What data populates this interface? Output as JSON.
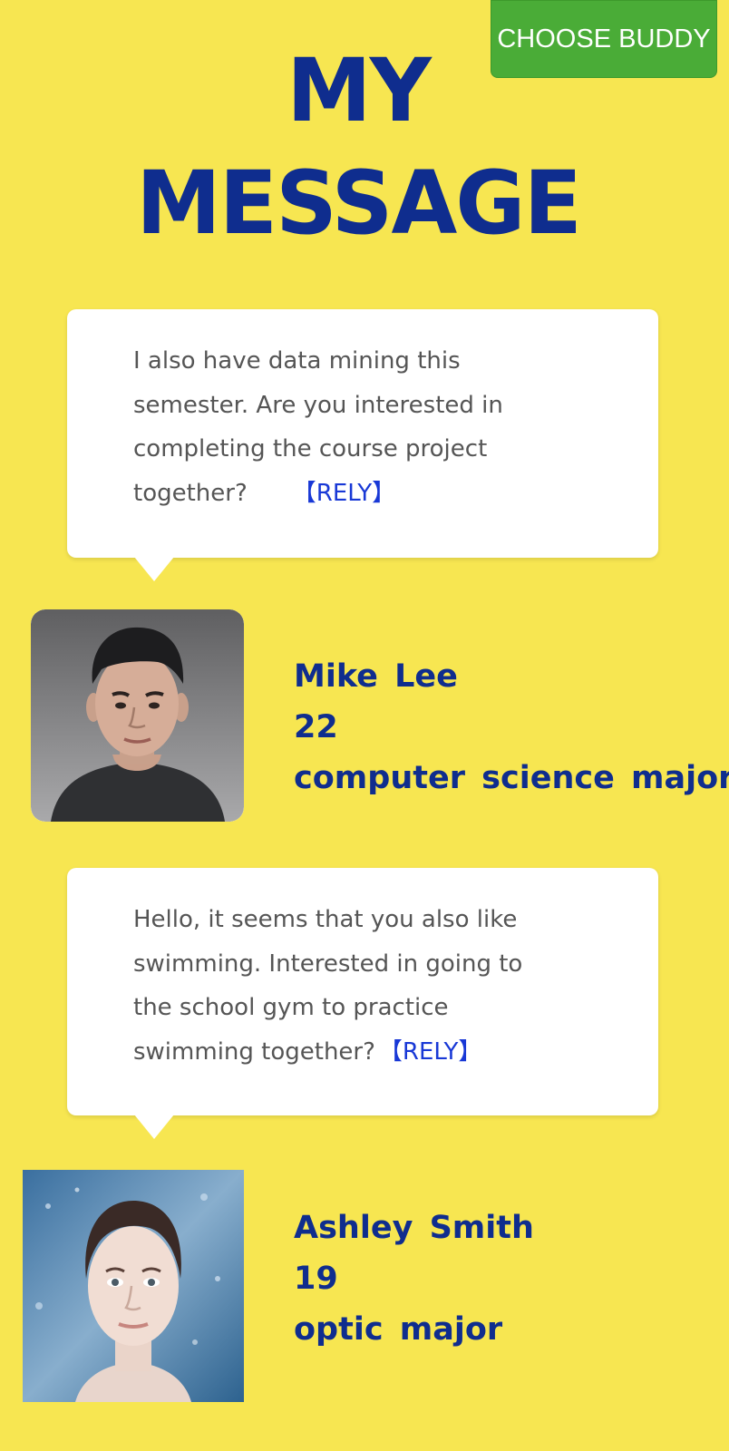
{
  "header": {
    "choose_buddy_label": "CHOOSE BUDDY",
    "title_line_1": "MY",
    "title_line_2": "MESSAGE"
  },
  "messages": [
    {
      "text": " I also have data mining this semester. Are you interested in completing the course project together?",
      "reply_label": "【RELY】",
      "sender": {
        "name": "Mike Lee",
        "age": "22",
        "major": "computer science major"
      }
    },
    {
      "text": "Hello, it seems that you also like swimming. Interested in going to the school gym to practice swimming together?",
      "reply_label": "【RELY】",
      "sender": {
        "name": "Ashley Smith",
        "age": "19",
        "major": "optic major"
      }
    }
  ],
  "colors": {
    "background": "#f7e651",
    "title": "#0f2d8e",
    "button": "#4aac37",
    "reply_link": "#1838d6",
    "message_text": "#555555"
  }
}
